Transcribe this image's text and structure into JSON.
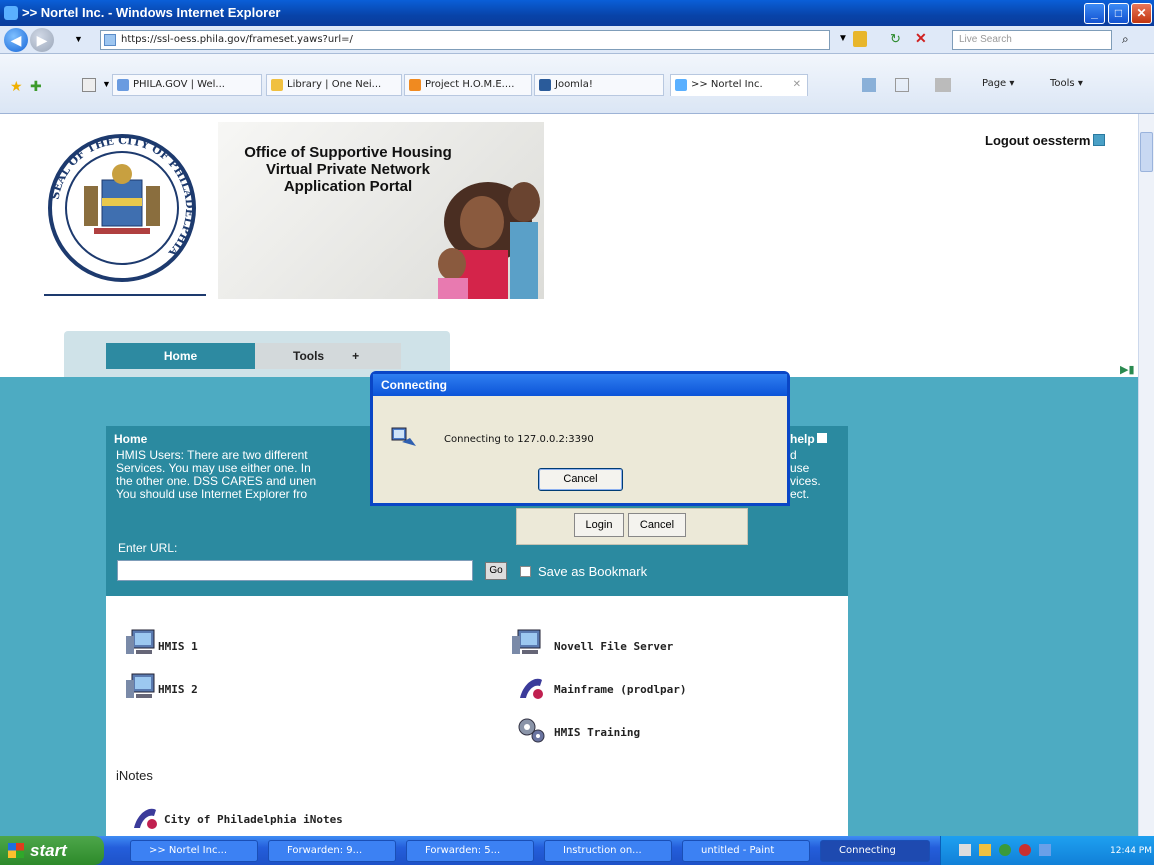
{
  "window": {
    "title": ">> Nortel Inc. - Windows Internet Explorer"
  },
  "browser": {
    "address": "https://ssl-oess.phila.gov/frameset.yaws?url=/",
    "search_placeholder": "Live Search",
    "favorites": [
      "PHILA.GOV | Wel...",
      "Library | One Nei...",
      "Project H.O.M.E....",
      "Joomla!"
    ],
    "active_tab": ">> Nortel Inc.",
    "toolbar": {
      "page": "Page",
      "tools": "Tools"
    }
  },
  "page": {
    "banner_lines": [
      "Office of Supportive Housing",
      "Virtual Private Network",
      "Application Portal"
    ],
    "seal_text": "SEAL OF THE CITY OF PHILADELPHIA",
    "logout": "Logout oessterm",
    "nav": {
      "home": "Home",
      "tools": "Tools",
      "tools_more": "+"
    },
    "home_panel": {
      "title": "Home",
      "help": "help",
      "lines": [
        "HMIS Users: There are two different",
        "Services. You may use either one. In",
        "the other one. DSS CARES and unen",
        "You should use Internet Explorer fro"
      ],
      "right_fragments": [
        "d",
        "use",
        "vices.",
        "ect."
      ],
      "enter_url_label": "Enter URL:",
      "go": "Go",
      "bookmark": "Save as Bookmark"
    },
    "login_box": {
      "login": "Login",
      "cancel": "Cancel"
    },
    "apps_left": [
      "HMIS 1",
      "HMIS 2"
    ],
    "apps_right": [
      "Novell File Server",
      "Mainframe (prodlpar)",
      "HMIS Training"
    ],
    "inotes_label": "iNotes",
    "inotes_app": "City of Philadelphia iNotes"
  },
  "dialog": {
    "title": "Connecting",
    "message": "Connecting to 127.0.0.2:3390",
    "cancel": "Cancel"
  },
  "taskbar": {
    "start": "start",
    "tasks": [
      ">> Nortel Inc...",
      "Forwarden: 9...",
      "Forwarden: 5...",
      "Instruction on...",
      "untitled - Paint",
      "Connecting"
    ],
    "clock": "12:44 PM"
  }
}
